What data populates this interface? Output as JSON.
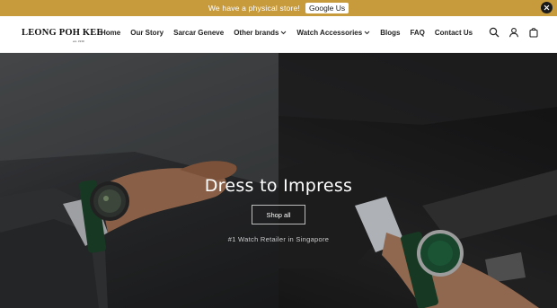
{
  "announcement": {
    "text": "We have a physical store!",
    "button_label": "Google Us",
    "close_icon": "close-icon"
  },
  "header": {
    "logo_text": "LEONG POH KEE",
    "logo_sub": "est. 1930",
    "nav": [
      {
        "label": "Home",
        "dropdown": false
      },
      {
        "label": "Our Story",
        "dropdown": false
      },
      {
        "label": "Sarcar Geneve",
        "dropdown": false
      },
      {
        "label": "Other brands",
        "dropdown": true
      },
      {
        "label": "Watch Accessories",
        "dropdown": true
      },
      {
        "label": "Blogs",
        "dropdown": false
      },
      {
        "label": "FAQ",
        "dropdown": false
      },
      {
        "label": "Contact Us",
        "dropdown": false
      }
    ],
    "icons": [
      "search-icon",
      "account-icon",
      "cart-icon"
    ]
  },
  "hero": {
    "title": "Dress to Impress",
    "button_label": "Shop all",
    "subtitle": "#1 Watch Retailer in Singapore"
  },
  "colors": {
    "announcement_bg": "#c79a3c",
    "watch_dial_green": "#1f5a3a",
    "strap_green": "#1e4a2e"
  }
}
